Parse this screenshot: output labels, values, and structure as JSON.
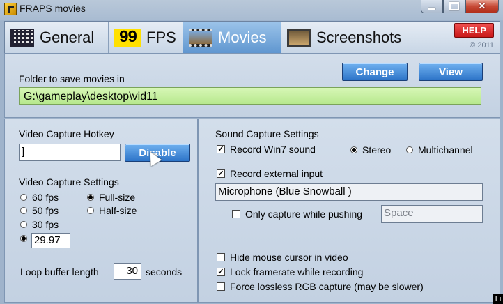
{
  "window": {
    "title": "FRAPS movies",
    "corner_text": "Li"
  },
  "tabs": [
    {
      "label": "General",
      "icon": "grid-icon"
    },
    {
      "label": "FPS",
      "icon_text": "99"
    },
    {
      "label": "Movies",
      "icon": "film-icon",
      "active": true
    },
    {
      "label": "Screenshots",
      "icon": "photo-icon"
    }
  ],
  "help": {
    "label": "HELP",
    "copyright": "© 2011"
  },
  "folder": {
    "label": "Folder to save movies in",
    "path": "G:\\gameplay\\desktop\\vid11",
    "change_label": "Change",
    "view_label": "View"
  },
  "video_hotkey": {
    "label": "Video Capture Hotkey",
    "value": "]",
    "disable_label": "Disable"
  },
  "video_settings": {
    "label": "Video Capture Settings",
    "fps_options": [
      "60 fps",
      "50 fps",
      "30 fps"
    ],
    "custom_fps": "29.97",
    "size_options": [
      "Full-size",
      "Half-size"
    ],
    "selected_size": "Full-size"
  },
  "loop_buffer": {
    "label": "Loop buffer length",
    "value": "30",
    "unit": "seconds"
  },
  "sound": {
    "label": "Sound Capture Settings",
    "record_win7": "Record Win7 sound",
    "stereo": "Stereo",
    "multichannel": "Multichannel",
    "record_external": "Record external input",
    "device": "Microphone (Blue Snowball )",
    "only_capture": "Only capture while pushing",
    "push_key": "Space"
  },
  "options": {
    "hide_cursor": "Hide mouse cursor in video",
    "lock_framerate": "Lock framerate while recording",
    "force_lossless": "Force lossless RGB capture (may be slower)"
  }
}
